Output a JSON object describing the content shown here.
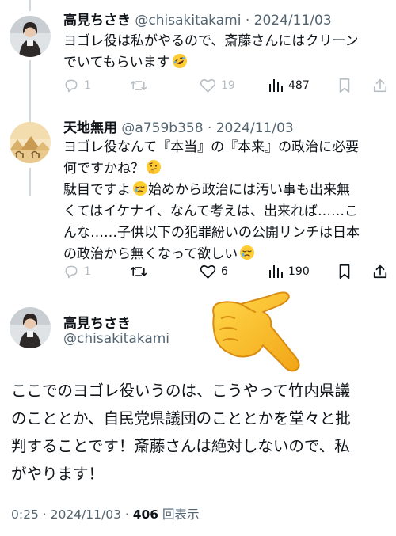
{
  "replies": [
    {
      "name": "高見ちさき",
      "handle": "@chisakitakami",
      "date": "2024/11/03",
      "lines": [
        "ヨゴレ役は私がやるので、斎藤さんにはクリーン",
        "でいてもらいます"
      ],
      "line_emojis": [
        "",
        "rofl-emoji"
      ],
      "reply_count": "1",
      "retweet_count": "",
      "like_count": "19",
      "view_count": "487"
    },
    {
      "name": "天地無用",
      "handle": "@a759b358",
      "date": "2024/11/03",
      "lines": [
        "ヨゴレ役なんて『本当』の『本来』の政治に必要",
        "何ですかね？",
        "駄目ですよ",
        "くてはイケナイ、なんて考えは、出来れば……こ",
        "んな……子供以下の犯罪紛いの公開リンチは日本",
        "の政治から無くなって欲しい"
      ],
      "line3_tail": "始めから政治には汚い事も出来無",
      "line_emojis": [
        "",
        "thinking-emoji",
        "crying-emoji",
        "",
        "",
        "crying-emoji"
      ],
      "reply_count": "1",
      "retweet_count": "",
      "like_count": "6",
      "view_count": "190"
    }
  ],
  "main": {
    "name": "高見ちさき",
    "handle": "@chisakitakami",
    "lines": [
      "ここでのヨゴレ役いうのは、こうやって竹内県議",
      "のこととか、自民党県議団のこととかを堂々と批",
      "判することです！斎藤さんは絶対しないので、私",
      "がやります！"
    ],
    "time": "0:25",
    "date": "2024/11/03",
    "views": "406",
    "views_label": "回表示"
  },
  "colors": {
    "text": "#0f1419",
    "secondary": "#536471",
    "thread_line": "#cfd9de"
  },
  "icons": [
    "reply-icon",
    "retweet-icon",
    "like-icon",
    "views-icon",
    "bookmark-icon",
    "share-icon",
    "pointing-hand-emoji"
  ]
}
